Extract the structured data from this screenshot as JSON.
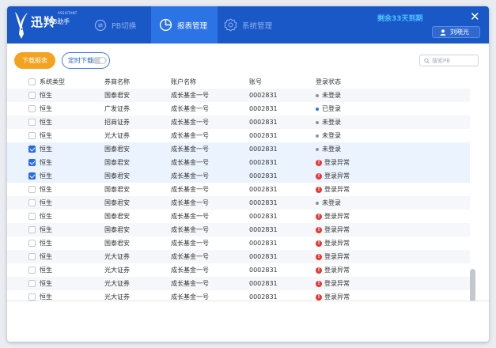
{
  "app": {
    "logo_title": "迅羚",
    "logo_subtitle": "PB助手",
    "logo_tag": "ASSISTANT"
  },
  "nav": [
    {
      "label": "PB切换",
      "icon": "switch-icon",
      "active": false
    },
    {
      "label": "报表管理",
      "icon": "pie-chart-icon",
      "active": true
    },
    {
      "label": "系统管理",
      "icon": "gear-icon",
      "active": false
    }
  ],
  "header": {
    "expire_text": "剩余33天到期",
    "user_name": "刘晓光",
    "close_icon": "close-icon"
  },
  "toolbar": {
    "download_label": "下载报表",
    "schedule_label": "定时下载",
    "schedule_enabled": false,
    "search_placeholder": "搜索PB",
    "search_value": ""
  },
  "colors": {
    "header_bg": "#1a58c8",
    "nav_active_bg": "#2c73e6",
    "accent_orange": "#f4a320",
    "expire_text": "#4ec0ff",
    "status_error": "#e53935",
    "status_logged_in": "#2d6fe6",
    "checkbox_checked": "#2a6be0"
  },
  "table": {
    "columns": [
      "系统类型",
      "券商名称",
      "账户名称",
      "账号",
      "登录状态"
    ],
    "rows": [
      {
        "type": "恒生",
        "broker": "国泰君安",
        "account": "成长基金一号",
        "number": "0002831",
        "status": "未登录",
        "status_kind": "grey",
        "checked": false
      },
      {
        "type": "恒生",
        "broker": "广发证券",
        "account": "成长基金一号",
        "number": "0002831",
        "status": "已登录",
        "status_kind": "blue",
        "checked": false
      },
      {
        "type": "恒生",
        "broker": "招商证券",
        "account": "成长基金一号",
        "number": "0002831",
        "status": "未登录",
        "status_kind": "grey",
        "checked": false
      },
      {
        "type": "恒生",
        "broker": "光大证券",
        "account": "成长基金一号",
        "number": "0002831",
        "status": "未登录",
        "status_kind": "grey",
        "checked": false
      },
      {
        "type": "恒生",
        "broker": "国泰君安",
        "account": "成长基金一号",
        "number": "0002831",
        "status": "未登录",
        "status_kind": "grey",
        "checked": true
      },
      {
        "type": "恒生",
        "broker": "国泰君安",
        "account": "成长基金一号",
        "number": "0002831",
        "status": "登录异常",
        "status_kind": "error",
        "checked": true
      },
      {
        "type": "恒生",
        "broker": "国泰君安",
        "account": "成长基金一号",
        "number": "0002831",
        "status": "登录异常",
        "status_kind": "error",
        "checked": true
      },
      {
        "type": "恒生",
        "broker": "国泰君安",
        "account": "成长基金一号",
        "number": "0002831",
        "status": "登录异常",
        "status_kind": "error",
        "checked": false
      },
      {
        "type": "恒生",
        "broker": "国泰君安",
        "account": "成长基金一号",
        "number": "0002831",
        "status": "未登录",
        "status_kind": "grey",
        "checked": false
      },
      {
        "type": "恒生",
        "broker": "国泰君安",
        "account": "成长基金一号",
        "number": "0002831",
        "status": "登录异常",
        "status_kind": "error",
        "checked": false
      },
      {
        "type": "恒生",
        "broker": "国泰君安",
        "account": "成长基金一号",
        "number": "0002831",
        "status": "登录异常",
        "status_kind": "error",
        "checked": false
      },
      {
        "type": "恒生",
        "broker": "国泰君安",
        "account": "成长基金一号",
        "number": "0002831",
        "status": "登录异常",
        "status_kind": "error",
        "checked": false
      },
      {
        "type": "恒生",
        "broker": "光大证券",
        "account": "成长基金一号",
        "number": "0002831",
        "status": "登录异常",
        "status_kind": "error",
        "checked": false
      },
      {
        "type": "恒生",
        "broker": "光大证券",
        "account": "成长基金一号",
        "number": "0002831",
        "status": "登录异常",
        "status_kind": "error",
        "checked": false
      },
      {
        "type": "恒生",
        "broker": "光大证券",
        "account": "成长基金一号",
        "number": "0002831",
        "status": "登录异常",
        "status_kind": "error",
        "checked": false
      },
      {
        "type": "恒生",
        "broker": "光大证券",
        "account": "成长基金一号",
        "number": "0002831",
        "status": "登录异常",
        "status_kind": "error",
        "checked": false
      }
    ]
  }
}
